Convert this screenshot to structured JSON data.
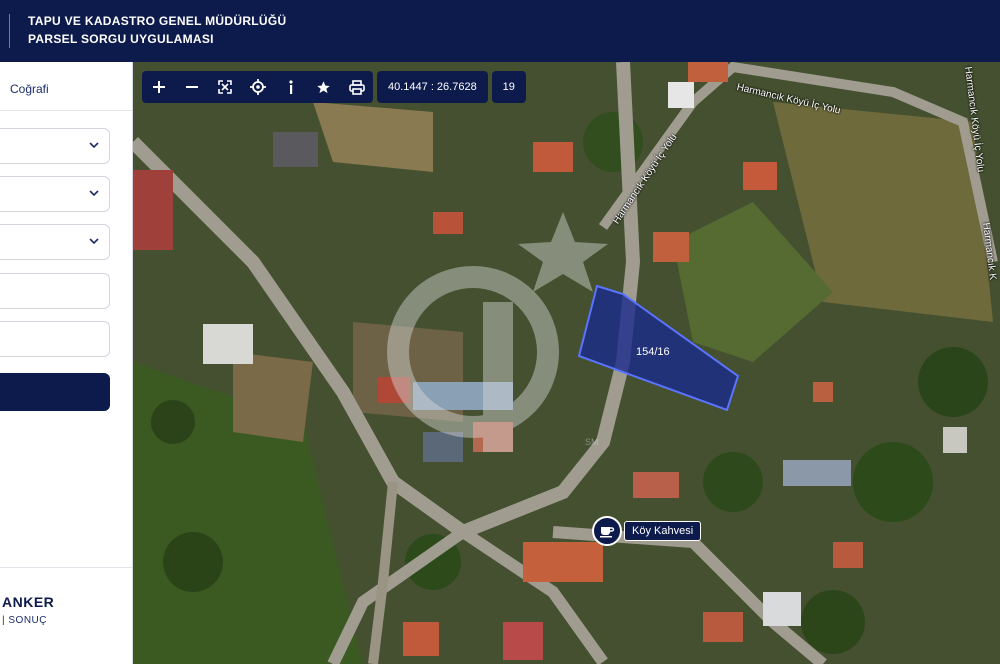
{
  "header": {
    "title_line1": "TAPU VE KADASTRO GENEL MÜDÜRLÜĞÜ",
    "title_line2": "PARSEL SORGU UYGULAMASI"
  },
  "sidebar": {
    "tab_label": "Coğrafi",
    "fields": [
      {
        "type": "select",
        "value": ""
      },
      {
        "type": "select",
        "value": ""
      },
      {
        "type": "select",
        "value": ""
      },
      {
        "type": "input",
        "value": ""
      },
      {
        "type": "input",
        "value": ""
      }
    ],
    "brand_name": "ANKER",
    "brand_sub": "| SONUÇ"
  },
  "toolbar": {
    "buttons": [
      "plus-icon",
      "minus-icon",
      "fullscreen-icon",
      "locate-icon",
      "info-icon",
      "star-icon",
      "print-icon"
    ],
    "coordinates": "40.1447 : 26.7628",
    "zoom_level": "19"
  },
  "map": {
    "parcel_label": "154/16",
    "road_name_1": "Harmancık Köyü İç Yolu",
    "road_name_2": "Harmancık Köyü İç Yolu",
    "road_name_3": "Harmancık Köyü İç Yolu",
    "road_name_4": "Harmancık K",
    "poi_label": "Köy Kahvesi",
    "poi_icon": "coffee-cup-icon",
    "watermark_text": "SM",
    "colors": {
      "parcel_fill": "#1a2a8c",
      "parcel_border": "#5a74ff",
      "navy": "#0d1b4c"
    }
  }
}
